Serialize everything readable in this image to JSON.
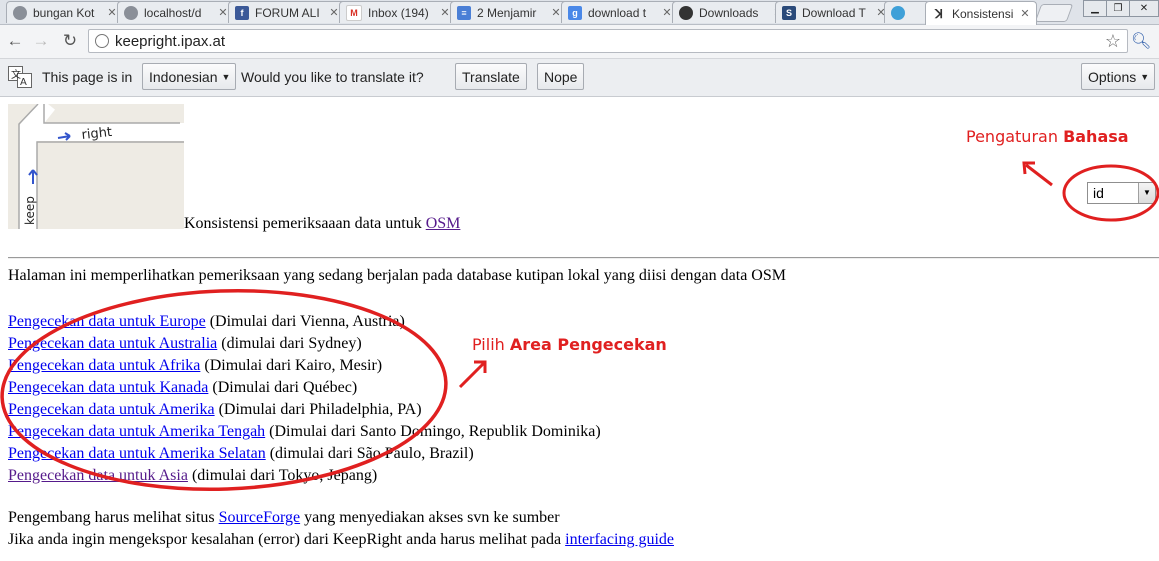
{
  "browser": {
    "tabs": [
      {
        "label": "bungan Kot",
        "icon": "globe-icon"
      },
      {
        "label": "localhost/d",
        "icon": "globe-icon"
      },
      {
        "label": "FORUM ALI",
        "icon": "facebook-icon"
      },
      {
        "label": "Inbox (194)",
        "icon": "gmail-icon"
      },
      {
        "label": "2 Menjamir",
        "icon": "docs-icon"
      },
      {
        "label": "download t",
        "icon": "google-icon"
      },
      {
        "label": "Downloads",
        "icon": "github-icon"
      },
      {
        "label": "Download T",
        "icon": "stackexchange-icon"
      },
      {
        "label": "",
        "icon": "world-icon"
      },
      {
        "label": "Konsistensi",
        "icon": "keepright-icon"
      }
    ],
    "url": "keepright.ipax.at"
  },
  "translate_bar": {
    "prefix": "This page is in",
    "language": "Indonesian",
    "question": "Would you like to translate it?",
    "translate_label": "Translate",
    "nope_label": "Nope",
    "options_label": "Options"
  },
  "page": {
    "logo_words": [
      "right",
      "keep"
    ],
    "subtitle_text": "Konsistensi pemeriksaaan data untuk",
    "subtitle_link": "OSM",
    "intro": "Halaman ini memperlihatkan pemeriksaan yang sedang berjalan pada database kutipan lokal yang diisi dengan data OSM",
    "areas": [
      {
        "link": "Pengecekan data untuk Europe",
        "note": " (Dimulai dari Vienna, Austria)"
      },
      {
        "link": "Pengecekan data untuk Australia",
        "note": " (dimulai dari Sydney)"
      },
      {
        "link": "Pengecekan data untuk Afrika",
        "note": " (Dimulai dari Kairo, Mesir)"
      },
      {
        "link": "Pengecekan data untuk Kanada",
        "note": " (Dimulai dari Québec)"
      },
      {
        "link": "Pengecekan data untuk Amerika",
        "note": " (Dimulai dari Philadelphia, PA)"
      },
      {
        "link": "Pengecekan data untuk Amerika Tengah",
        "note": " (Dimulai dari Santo Domingo, Republik Dominika)"
      },
      {
        "link": "Pengecekan data untuk Amerika Selatan",
        "note": " (dimulai dari São Paulo, Brazil)"
      },
      {
        "link": "Pengecekan data untuk Asia",
        "note": " (dimulai dari Tokyo, Jepang)"
      }
    ],
    "dev_text_1": "Pengembang harus melihat situs",
    "dev_link_1": "SourceForge",
    "dev_text_1b": "yang menyediakan akses svn ke sumber",
    "dev_text_2": "Jika anda ingin mengekspor kesalahan (error) dari KeepRight anda harus melihat pada",
    "dev_link_2": "interfacing guide",
    "language_select": "id"
  },
  "annotations": {
    "language_note_plain": "Pengaturan",
    "language_note_bold": "Bahasa",
    "area_note_plain": "Pilih",
    "area_note_bold": "Area Pengecekan",
    "color": "#e02020"
  }
}
